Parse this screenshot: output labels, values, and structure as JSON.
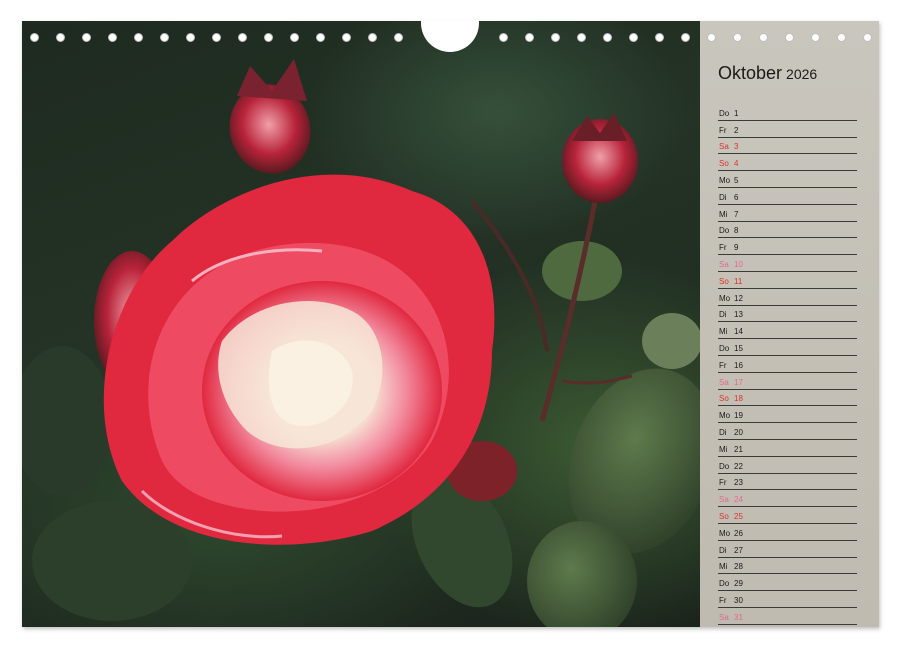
{
  "calendar": {
    "month": "Oktober",
    "year": "2026",
    "days": [
      {
        "wd": "Do",
        "d": "1",
        "type": "weekday"
      },
      {
        "wd": "Fr",
        "d": "2",
        "type": "weekday"
      },
      {
        "wd": "Sa",
        "d": "3",
        "type": "sun"
      },
      {
        "wd": "So",
        "d": "4",
        "type": "sun"
      },
      {
        "wd": "Mo",
        "d": "5",
        "type": "weekday"
      },
      {
        "wd": "Di",
        "d": "6",
        "type": "weekday"
      },
      {
        "wd": "Mi",
        "d": "7",
        "type": "weekday"
      },
      {
        "wd": "Do",
        "d": "8",
        "type": "weekday"
      },
      {
        "wd": "Fr",
        "d": "9",
        "type": "weekday"
      },
      {
        "wd": "Sa",
        "d": "10",
        "type": "sat"
      },
      {
        "wd": "So",
        "d": "11",
        "type": "sun"
      },
      {
        "wd": "Mo",
        "d": "12",
        "type": "weekday"
      },
      {
        "wd": "Di",
        "d": "13",
        "type": "weekday"
      },
      {
        "wd": "Mi",
        "d": "14",
        "type": "weekday"
      },
      {
        "wd": "Do",
        "d": "15",
        "type": "weekday"
      },
      {
        "wd": "Fr",
        "d": "16",
        "type": "weekday"
      },
      {
        "wd": "Sa",
        "d": "17",
        "type": "sat"
      },
      {
        "wd": "So",
        "d": "18",
        "type": "sun"
      },
      {
        "wd": "Mo",
        "d": "19",
        "type": "weekday"
      },
      {
        "wd": "Di",
        "d": "20",
        "type": "weekday"
      },
      {
        "wd": "Mi",
        "d": "21",
        "type": "weekday"
      },
      {
        "wd": "Do",
        "d": "22",
        "type": "weekday"
      },
      {
        "wd": "Fr",
        "d": "23",
        "type": "weekday"
      },
      {
        "wd": "Sa",
        "d": "24",
        "type": "sat"
      },
      {
        "wd": "So",
        "d": "25",
        "type": "sun"
      },
      {
        "wd": "Mo",
        "d": "26",
        "type": "weekday"
      },
      {
        "wd": "Di",
        "d": "27",
        "type": "weekday"
      },
      {
        "wd": "Mi",
        "d": "28",
        "type": "weekday"
      },
      {
        "wd": "Do",
        "d": "29",
        "type": "weekday"
      },
      {
        "wd": "Fr",
        "d": "30",
        "type": "weekday"
      },
      {
        "wd": "Sa",
        "d": "31",
        "type": "sat"
      }
    ]
  },
  "binding": {
    "hole_count_left": 15,
    "hole_count_right": 15
  },
  "colors": {
    "panel": "#c6c2b9",
    "sunday": "#d8342c",
    "saturday": "#e06a8e",
    "rose": "#e0283f"
  },
  "photo": {
    "subject_icon": "rose-photo"
  }
}
